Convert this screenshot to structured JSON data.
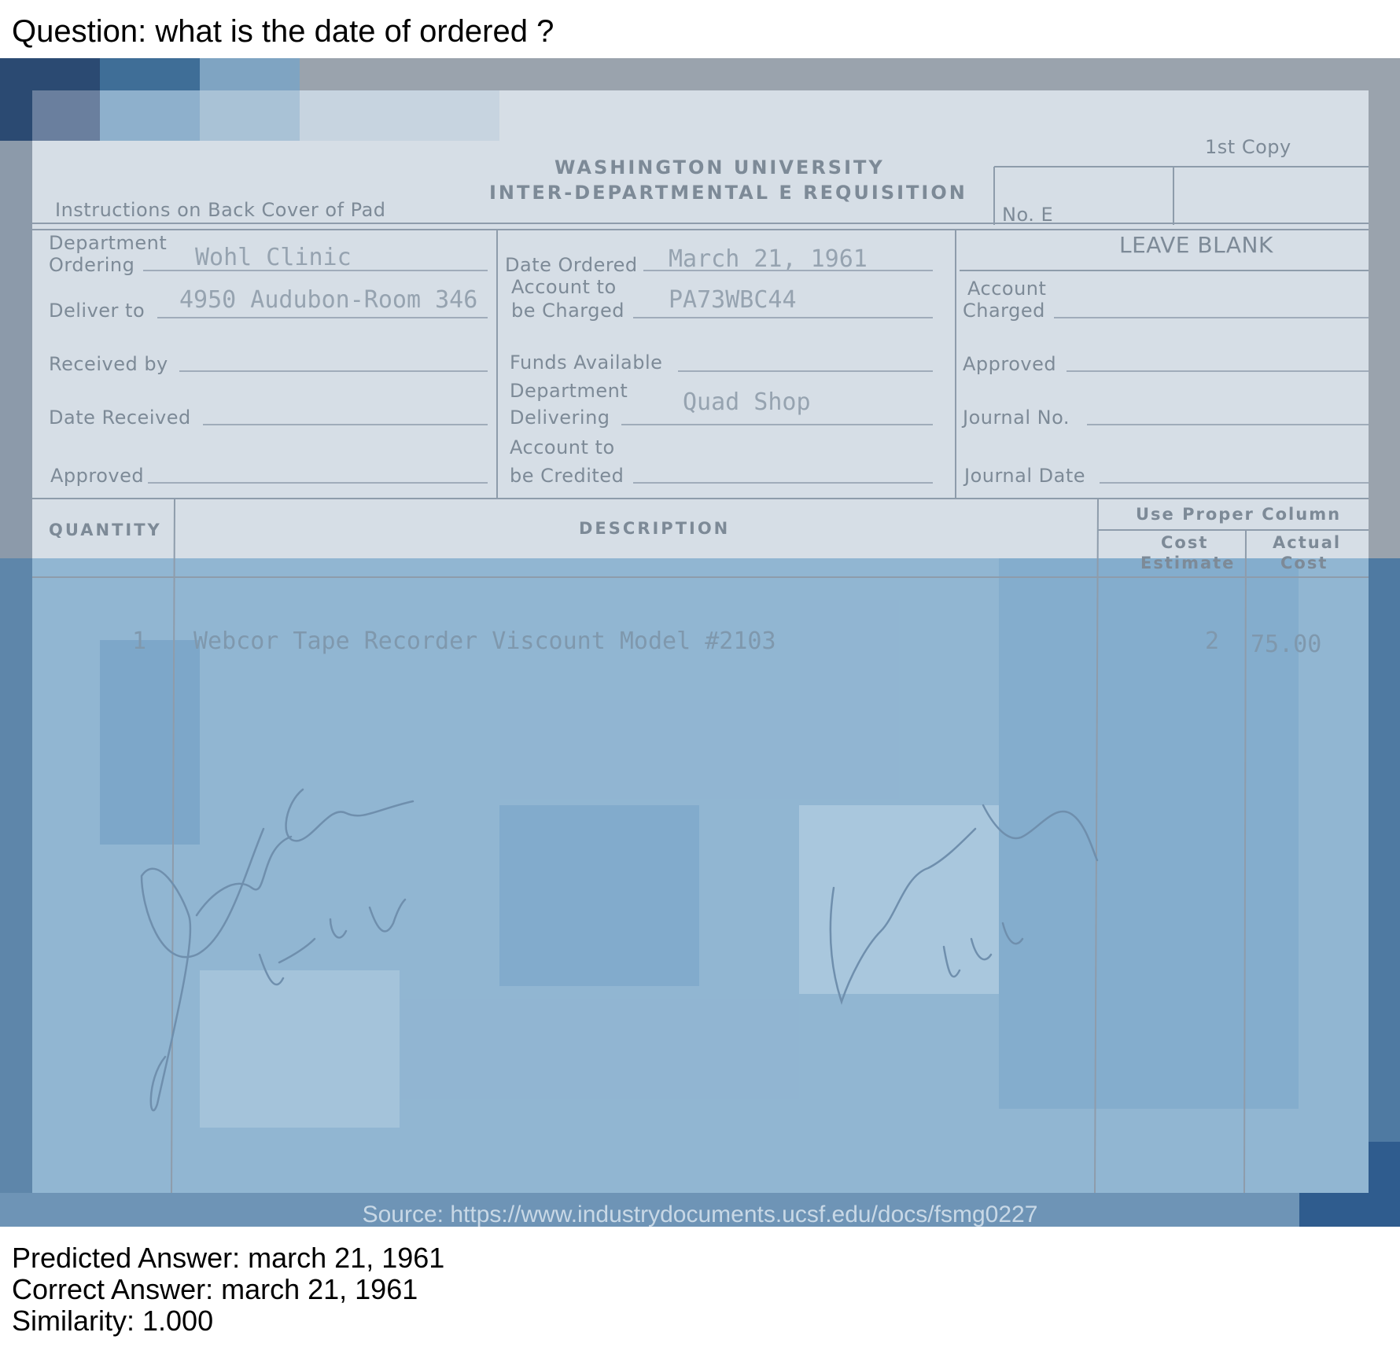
{
  "question": "Question: what is the date of ordered ?",
  "form": {
    "copy": "1st Copy",
    "university": "WASHINGTON UNIVERSITY",
    "form_title": "INTER-DEPARTMENTAL E REQUISITION",
    "instructions": "Instructions on Back Cover of Pad",
    "number_label": "No. E",
    "leave_blank": "LEAVE BLANK",
    "labels": {
      "dept_ordering_1": "Department",
      "dept_ordering_2": "Ordering",
      "deliver_to": "Deliver to",
      "received_by": "Received by",
      "date_received": "Date Received",
      "approved_left": "Approved",
      "date_ordered": "Date Ordered",
      "account_charged_1": "Account to",
      "account_charged_2": "be Charged",
      "funds_available": "Funds Available",
      "dept_delivering_1": "Department",
      "dept_delivering_2": "Delivering",
      "account_credited_1": "Account to",
      "account_credited_2": "be Credited",
      "account_right_1": "Account",
      "account_right_2": "Charged",
      "approved_right": "Approved",
      "journal_no": "Journal No.",
      "journal_date": "Journal Date"
    },
    "values": {
      "dept_ordering": "Wohl Clinic",
      "deliver_to": "4950 Audubon-Room 346",
      "date_ordered": "March 21, 1961",
      "account_charged": "PA73WBC44",
      "dept_delivering": "Quad Shop"
    },
    "table": {
      "col_quantity": "QUANTITY",
      "col_description": "DESCRIPTION",
      "col_use_proper": "Use Proper Column",
      "col_cost_estimate_1": "Cost",
      "col_cost_estimate_2": "Estimate",
      "col_actual_cost_1": "Actual",
      "col_actual_cost_2": "Cost",
      "rows": [
        {
          "quantity": "1",
          "description": "Webcor Tape Recorder Viscount Model #2103",
          "estimate_mark": "2",
          "actual": "75.00"
        }
      ]
    }
  },
  "source": "Source: https://www.industrydocuments.ucsf.edu/docs/fsmg0227",
  "results": {
    "predicted": "Predicted Answer: march 21, 1961",
    "correct": "Correct Answer: march 21, 1961",
    "similarity": "Similarity: 1.000"
  }
}
